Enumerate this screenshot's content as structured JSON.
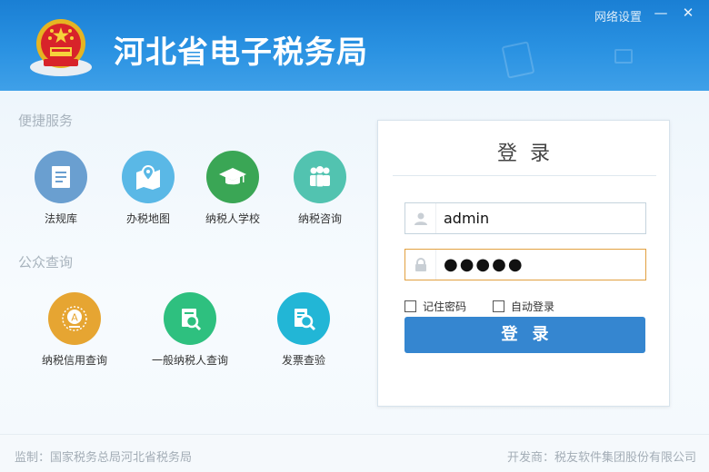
{
  "header": {
    "title": "河北省电子税务局",
    "network_settings": "网络设置",
    "minimize": "—",
    "close": "✕",
    "emblem_icon": "national-emblem-icon"
  },
  "quick_services": {
    "title": "便捷服务",
    "items": [
      {
        "label": "法规库",
        "icon": "law-library-icon",
        "color": "#6a9fd0"
      },
      {
        "label": "办税地图",
        "icon": "map-icon",
        "color": "#5ab8e6"
      },
      {
        "label": "纳税人学校",
        "icon": "graduation-cap-icon",
        "color": "#3aa655"
      },
      {
        "label": "纳税咨询",
        "icon": "consult-people-icon",
        "color": "#52c3b0"
      }
    ]
  },
  "public_query": {
    "title": "公众查询",
    "items": [
      {
        "label": "纳税信用查询",
        "icon": "credit-badge-icon",
        "color": "#e6a532"
      },
      {
        "label": "一般纳税人查询",
        "icon": "taxpayer-search-icon",
        "color": "#2ec07f"
      },
      {
        "label": "发票查验",
        "icon": "invoice-check-icon",
        "color": "#22b6d6"
      }
    ]
  },
  "login": {
    "title": "登录",
    "username_value": "admin",
    "password_value": "●●●●●",
    "remember_label": "记住密码",
    "auto_login_label": "自动登录",
    "submit_label": "登录",
    "accent_color": "#3586d0"
  },
  "footer": {
    "supervisor": "监制：国家税务总局河北省税务局",
    "developer": "开发商：税友软件集团股份有限公司"
  }
}
